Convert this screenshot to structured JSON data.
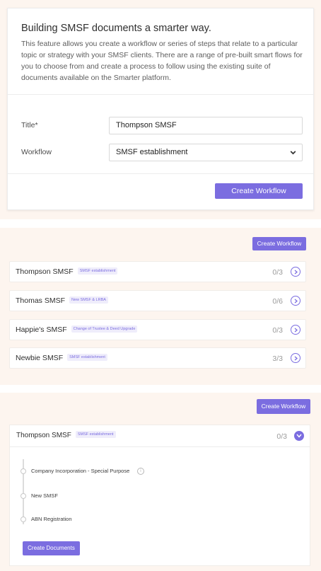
{
  "intro": {
    "title": "Building SMSF documents a smarter way.",
    "description": "This feature allows you create a workflow or series of steps that relate to a particular topic or strategy with your SMSF clients. There are a range of pre-built smart flows for you to choose from and create a process to follow using the existing suite of documents available on the Smarter platform."
  },
  "form": {
    "title_label": "Title*",
    "title_value": "Thompson SMSF",
    "workflow_label": "Workflow",
    "workflow_selected": "SMSF establishment",
    "submit_label": "Create Workflow"
  },
  "list": {
    "create_label": "Create Workflow",
    "items": [
      {
        "name": "Thompson SMSF",
        "badge": "SMSF establishment",
        "progress": "0/3"
      },
      {
        "name": "Thomas SMSF",
        "badge": "New SMSF & LRBA",
        "progress": "0/6"
      },
      {
        "name": "Happie's SMSF",
        "badge": "Change of Trustee & Deed Upgrade",
        "progress": "0/3"
      },
      {
        "name": "Newbie SMSF",
        "badge": "SMSF establishment",
        "progress": "3/3"
      }
    ]
  },
  "detail": {
    "create_label": "Create Workflow",
    "name": "Thompson SMSF",
    "badge": "SMSF establishment",
    "progress": "0/3",
    "steps": [
      "Company Incorporation - Special Purpose",
      "New SMSF",
      "ABN Registration"
    ],
    "info_glyph": "i",
    "create_documents_label": "Create Documents"
  },
  "colors": {
    "accent": "#7b6de0",
    "panel_bg": "#fdf5ef",
    "badge_bg": "#efedfb"
  },
  "icons": {
    "select_arrow": "chevron-down-icon",
    "row_expand": "chevron-right-icon",
    "row_collapse": "chevron-down-icon",
    "step_info": "info-icon"
  }
}
